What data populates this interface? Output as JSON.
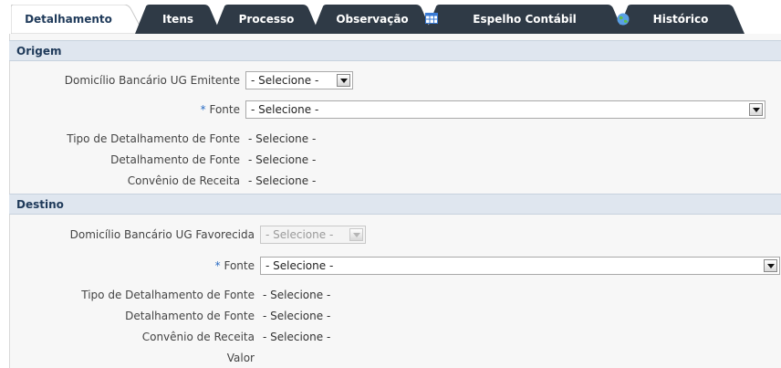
{
  "tabs": [
    {
      "label": "Detalhamento",
      "active": true
    },
    {
      "label": "Itens"
    },
    {
      "label": "Processo"
    },
    {
      "label": "Observação"
    },
    {
      "label": "Espelho Contábil",
      "icon": "spreadsheet-icon"
    },
    {
      "label": "Histórico",
      "icon": "globe-icon"
    }
  ],
  "origem": {
    "title": "Origem",
    "domicilio_label": "Domicílio Bancário UG Emitente",
    "domicilio_value": "- Selecione -",
    "fonte_label": "Fonte",
    "fonte_value": "- Selecione -",
    "tipo_label": "Tipo de Detalhamento de Fonte",
    "tipo_value": "- Selecione -",
    "detalhamento_label": "Detalhamento de Fonte",
    "detalhamento_value": "- Selecione -",
    "convenio_label": "Convênio de Receita",
    "convenio_value": "- Selecione -"
  },
  "destino": {
    "title": "Destino",
    "domicilio_label": "Domicílio Bancário UG Favorecida",
    "domicilio_value": "- Selecione -",
    "fonte_label": "Fonte",
    "fonte_value": "- Selecione -",
    "tipo_label": "Tipo de Detalhamento de Fonte",
    "tipo_value": "- Selecione -",
    "detalhamento_label": "Detalhamento de Fonte",
    "detalhamento_value": "- Selecione -",
    "convenio_label": "Convênio de Receita",
    "convenio_value": "- Selecione -",
    "valor_label": "Valor"
  },
  "required_marker": "*",
  "colors": {
    "tab_active": "#ffffff",
    "tab_inactive": "#2f3a46",
    "section_header_bg": "#dfe6ef",
    "section_header_text": "#1f3a5a",
    "required": "#2a6cc4"
  }
}
